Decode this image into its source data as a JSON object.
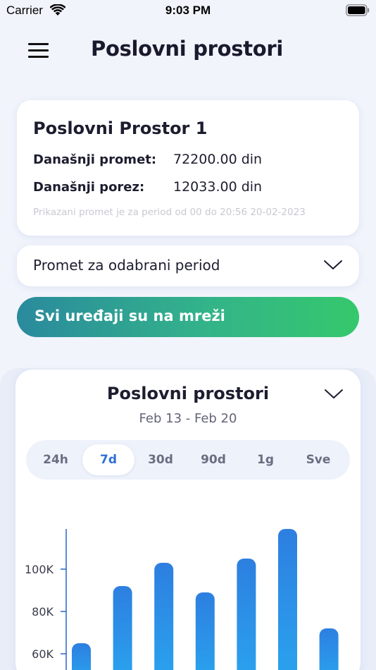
{
  "status_bar": {
    "carrier": "Carrier",
    "time": "9:03 PM",
    "icons": [
      "wifi-icon",
      "battery-icon"
    ]
  },
  "header": {
    "menu_icon": "hamburger-menu-icon",
    "title": "Poslovni prostori"
  },
  "shop_card": {
    "name": "Poslovni Prostor 1",
    "turnover_label": "Današnji promet:",
    "turnover_value": "72200.00 din",
    "tax_label": "Današnji porez:",
    "tax_value": "12033.00 din",
    "note": "Prikazani promet je za period od 00 do 20:56 20-02-2023"
  },
  "period_dropdown": {
    "label": "Promet za odabrani period",
    "icon": "chevron-down-icon"
  },
  "status_banner": {
    "text": "Svi uređaji su na mreži",
    "gradient": [
      "#2a8a9d",
      "#35c86c"
    ]
  },
  "chart_section": {
    "title": "Poslovni prostori",
    "date_range": "Feb 13 - Feb 20",
    "icon": "chevron-down-icon",
    "tabs": [
      {
        "label": "24h",
        "active": false
      },
      {
        "label": "7d",
        "active": true
      },
      {
        "label": "30d",
        "active": false
      },
      {
        "label": "90d",
        "active": false
      },
      {
        "label": "1g",
        "active": false
      },
      {
        "label": "Sve",
        "active": false
      }
    ]
  },
  "colors": {
    "accent": "#2f6fd6",
    "bar_top": "#2d7fe0",
    "bar_bottom": "#2aa3ee"
  },
  "chart_data": {
    "type": "bar",
    "title": "",
    "xlabel": "",
    "ylabel": "",
    "y_ticks": [
      "100K",
      "80K",
      "60K"
    ],
    "y_tick_values": [
      100000,
      80000,
      60000
    ],
    "values": [
      65000,
      92000,
      103000,
      89000,
      105000,
      119000,
      72000
    ],
    "ylim": [
      50000,
      125000
    ],
    "grid": false
  }
}
